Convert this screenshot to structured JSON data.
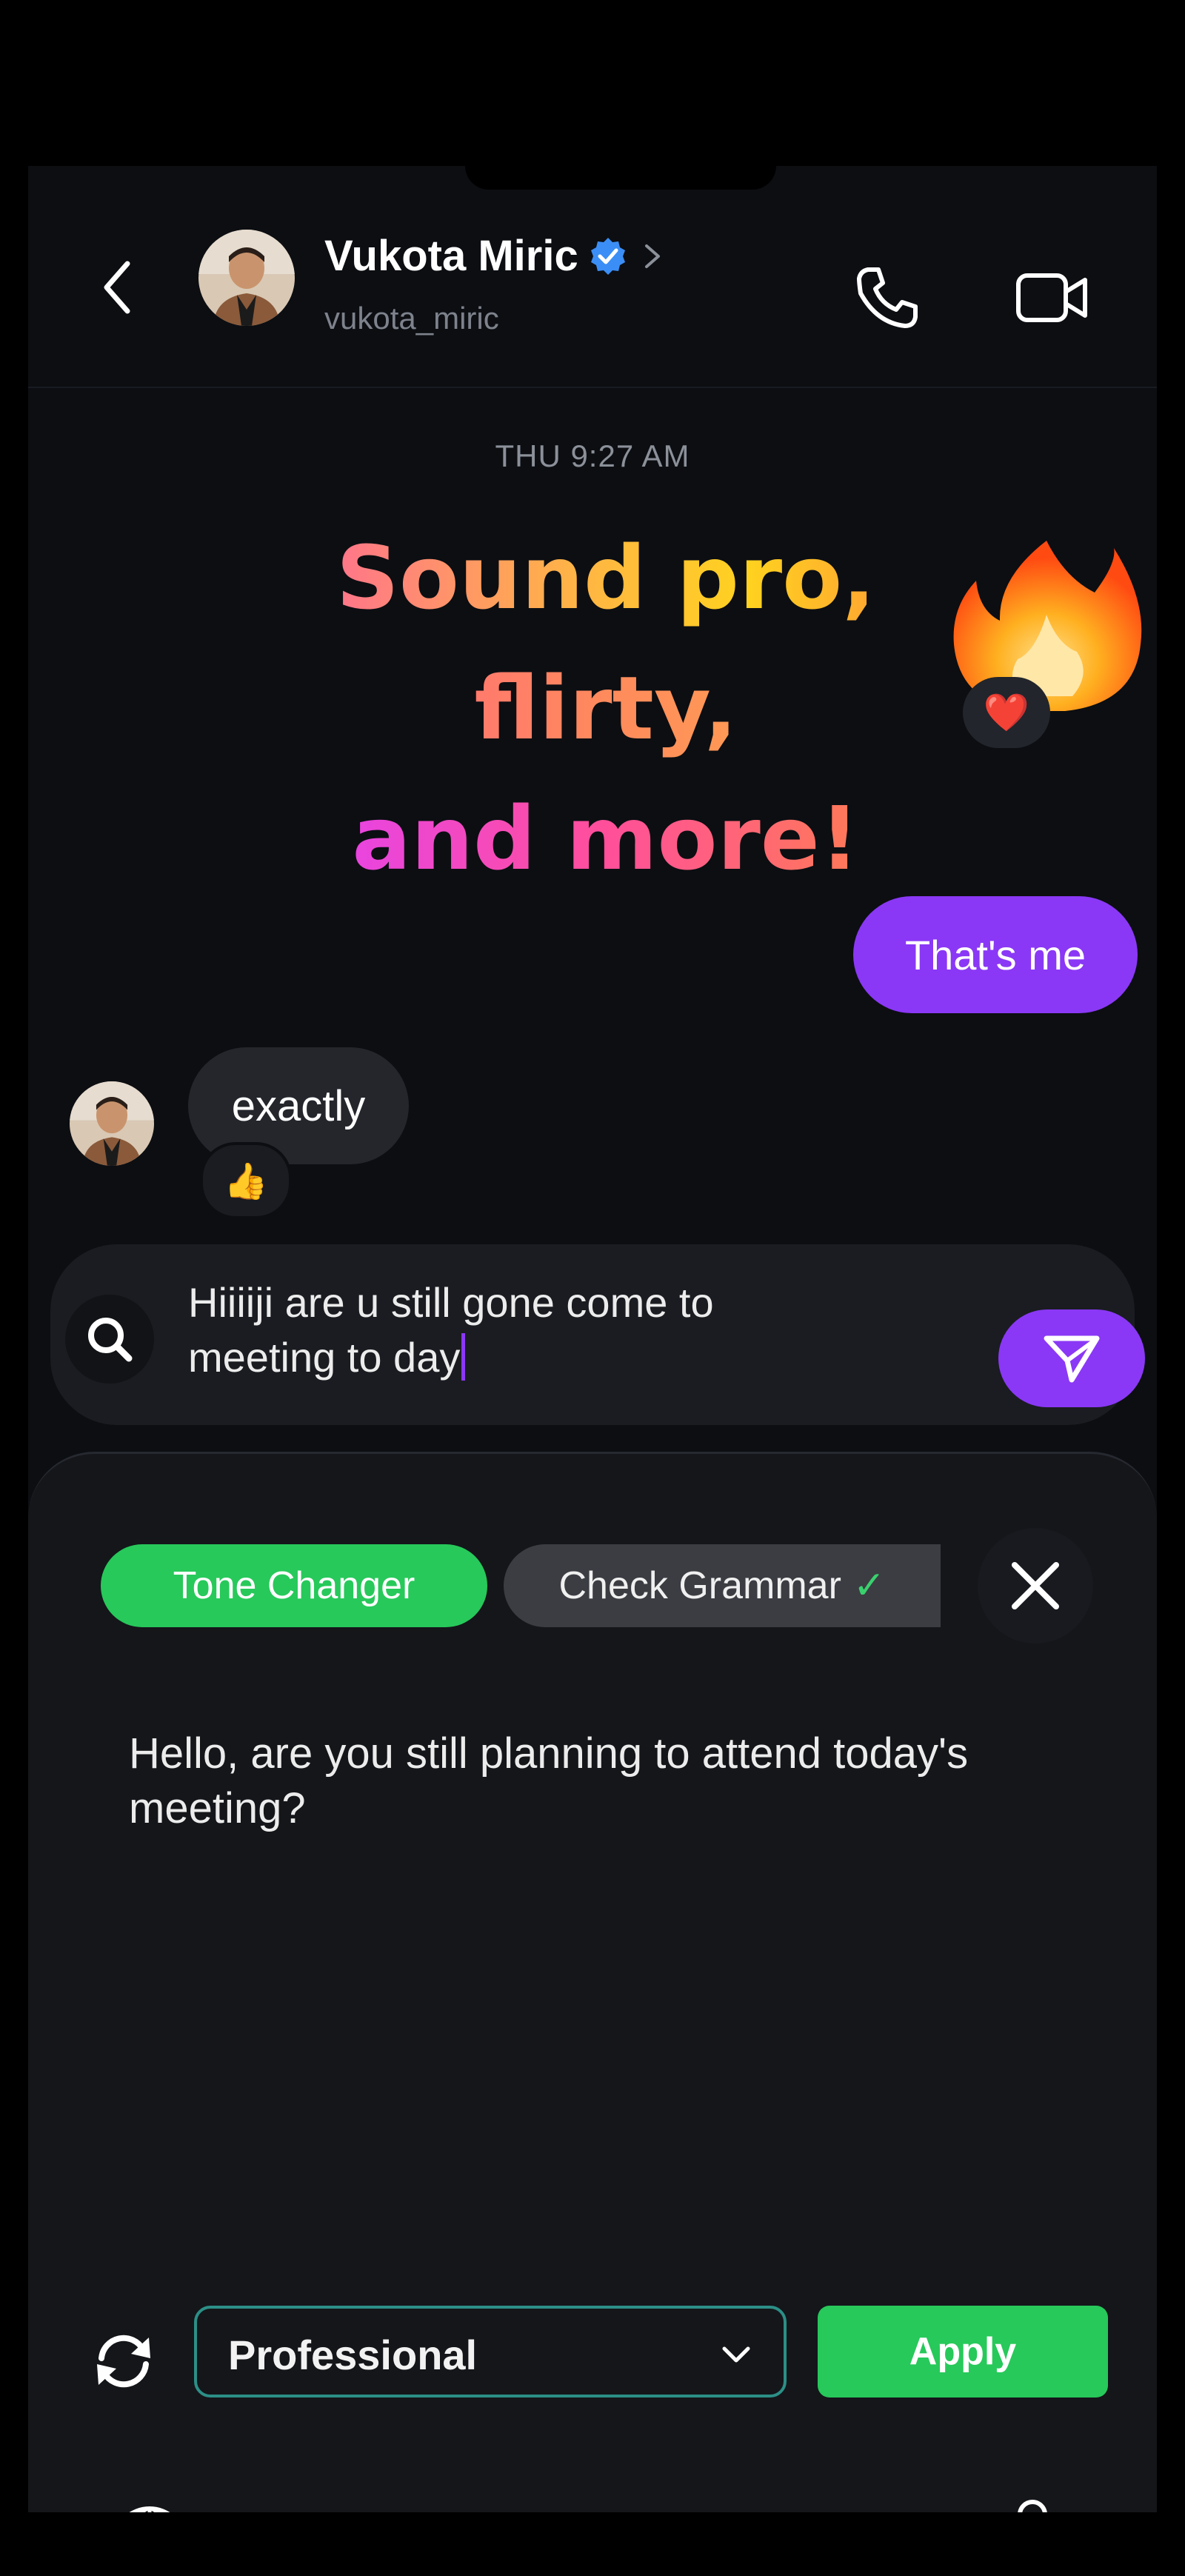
{
  "header": {
    "contact_name": "Vukota Miric",
    "contact_handle": "vukota_miric",
    "verified": true
  },
  "chat": {
    "timestamp_1": "THU 9:27 AM",
    "promo": {
      "line1": "Sound pro,",
      "line2": "flirty,",
      "line3": "and more!"
    },
    "fire_emoji_reaction": "❤️",
    "outgoing_message": "That's me",
    "incoming_message": "exactly",
    "incoming_reaction": "👍"
  },
  "composer": {
    "text": "Hiiiiji are u still gone come to\nmeeting to day"
  },
  "panel": {
    "tabs": [
      {
        "label": "Tone Changer",
        "active": true
      },
      {
        "label": "Check Grammar",
        "active": false
      }
    ],
    "grammar_check_mark": "✓",
    "result_text": "Hello, are you still planning to attend today's meeting?",
    "tone_select_value": "Professional",
    "apply_label": "Apply"
  },
  "colors": {
    "accent_purple": "#8a38f5",
    "accent_green": "#27c95a",
    "verified_blue": "#3b8ef5",
    "background": "#0c0e12"
  },
  "icons": {
    "back": "chevron-left-icon",
    "call": "phone-icon",
    "video": "video-camera-icon",
    "search": "search-icon",
    "send": "send-icon",
    "close": "close-icon",
    "refresh": "refresh-icon",
    "globe": "globe-icon",
    "mic": "microphone-icon"
  }
}
